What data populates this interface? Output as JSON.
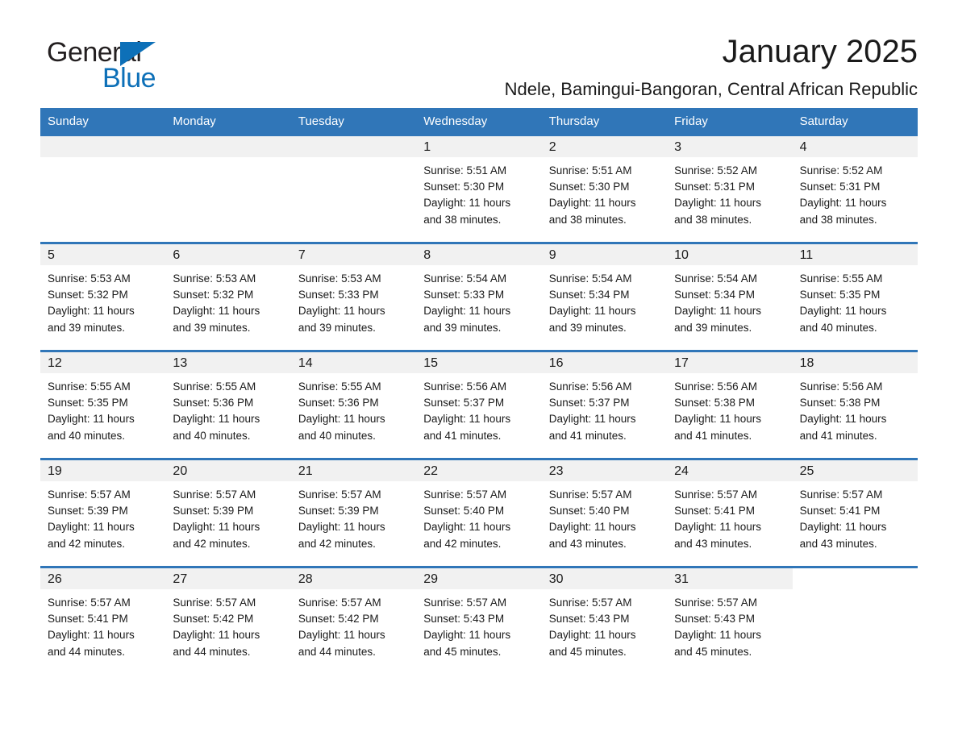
{
  "brand": {
    "word1": "General",
    "word2": "Blue",
    "triangle_color": "#0d70b8",
    "text_color": "#231f20"
  },
  "header": {
    "title": "January 2025",
    "location": "Ndele, Bamingui-Bangoran, Central African Republic",
    "accent_color": "#3076b8",
    "band_color": "#f1f1f1"
  },
  "calendar": {
    "weekday_headers": [
      "Sunday",
      "Monday",
      "Tuesday",
      "Wednesday",
      "Thursday",
      "Friday",
      "Saturday"
    ],
    "weeks": [
      [
        {
          "day": "",
          "empty": true
        },
        {
          "day": "",
          "empty": true
        },
        {
          "day": "",
          "empty": true
        },
        {
          "day": "1",
          "sunrise": "Sunrise: 5:51 AM",
          "sunset": "Sunset: 5:30 PM",
          "daylight": "Daylight: 11 hours and 38 minutes."
        },
        {
          "day": "2",
          "sunrise": "Sunrise: 5:51 AM",
          "sunset": "Sunset: 5:30 PM",
          "daylight": "Daylight: 11 hours and 38 minutes."
        },
        {
          "day": "3",
          "sunrise": "Sunrise: 5:52 AM",
          "sunset": "Sunset: 5:31 PM",
          "daylight": "Daylight: 11 hours and 38 minutes."
        },
        {
          "day": "4",
          "sunrise": "Sunrise: 5:52 AM",
          "sunset": "Sunset: 5:31 PM",
          "daylight": "Daylight: 11 hours and 38 minutes."
        }
      ],
      [
        {
          "day": "5",
          "sunrise": "Sunrise: 5:53 AM",
          "sunset": "Sunset: 5:32 PM",
          "daylight": "Daylight: 11 hours and 39 minutes."
        },
        {
          "day": "6",
          "sunrise": "Sunrise: 5:53 AM",
          "sunset": "Sunset: 5:32 PM",
          "daylight": "Daylight: 11 hours and 39 minutes."
        },
        {
          "day": "7",
          "sunrise": "Sunrise: 5:53 AM",
          "sunset": "Sunset: 5:33 PM",
          "daylight": "Daylight: 11 hours and 39 minutes."
        },
        {
          "day": "8",
          "sunrise": "Sunrise: 5:54 AM",
          "sunset": "Sunset: 5:33 PM",
          "daylight": "Daylight: 11 hours and 39 minutes."
        },
        {
          "day": "9",
          "sunrise": "Sunrise: 5:54 AM",
          "sunset": "Sunset: 5:34 PM",
          "daylight": "Daylight: 11 hours and 39 minutes."
        },
        {
          "day": "10",
          "sunrise": "Sunrise: 5:54 AM",
          "sunset": "Sunset: 5:34 PM",
          "daylight": "Daylight: 11 hours and 39 minutes."
        },
        {
          "day": "11",
          "sunrise": "Sunrise: 5:55 AM",
          "sunset": "Sunset: 5:35 PM",
          "daylight": "Daylight: 11 hours and 40 minutes."
        }
      ],
      [
        {
          "day": "12",
          "sunrise": "Sunrise: 5:55 AM",
          "sunset": "Sunset: 5:35 PM",
          "daylight": "Daylight: 11 hours and 40 minutes."
        },
        {
          "day": "13",
          "sunrise": "Sunrise: 5:55 AM",
          "sunset": "Sunset: 5:36 PM",
          "daylight": "Daylight: 11 hours and 40 minutes."
        },
        {
          "day": "14",
          "sunrise": "Sunrise: 5:55 AM",
          "sunset": "Sunset: 5:36 PM",
          "daylight": "Daylight: 11 hours and 40 minutes."
        },
        {
          "day": "15",
          "sunrise": "Sunrise: 5:56 AM",
          "sunset": "Sunset: 5:37 PM",
          "daylight": "Daylight: 11 hours and 41 minutes."
        },
        {
          "day": "16",
          "sunrise": "Sunrise: 5:56 AM",
          "sunset": "Sunset: 5:37 PM",
          "daylight": "Daylight: 11 hours and 41 minutes."
        },
        {
          "day": "17",
          "sunrise": "Sunrise: 5:56 AM",
          "sunset": "Sunset: 5:38 PM",
          "daylight": "Daylight: 11 hours and 41 minutes."
        },
        {
          "day": "18",
          "sunrise": "Sunrise: 5:56 AM",
          "sunset": "Sunset: 5:38 PM",
          "daylight": "Daylight: 11 hours and 41 minutes."
        }
      ],
      [
        {
          "day": "19",
          "sunrise": "Sunrise: 5:57 AM",
          "sunset": "Sunset: 5:39 PM",
          "daylight": "Daylight: 11 hours and 42 minutes."
        },
        {
          "day": "20",
          "sunrise": "Sunrise: 5:57 AM",
          "sunset": "Sunset: 5:39 PM",
          "daylight": "Daylight: 11 hours and 42 minutes."
        },
        {
          "day": "21",
          "sunrise": "Sunrise: 5:57 AM",
          "sunset": "Sunset: 5:39 PM",
          "daylight": "Daylight: 11 hours and 42 minutes."
        },
        {
          "day": "22",
          "sunrise": "Sunrise: 5:57 AM",
          "sunset": "Sunset: 5:40 PM",
          "daylight": "Daylight: 11 hours and 42 minutes."
        },
        {
          "day": "23",
          "sunrise": "Sunrise: 5:57 AM",
          "sunset": "Sunset: 5:40 PM",
          "daylight": "Daylight: 11 hours and 43 minutes."
        },
        {
          "day": "24",
          "sunrise": "Sunrise: 5:57 AM",
          "sunset": "Sunset: 5:41 PM",
          "daylight": "Daylight: 11 hours and 43 minutes."
        },
        {
          "day": "25",
          "sunrise": "Sunrise: 5:57 AM",
          "sunset": "Sunset: 5:41 PM",
          "daylight": "Daylight: 11 hours and 43 minutes."
        }
      ],
      [
        {
          "day": "26",
          "sunrise": "Sunrise: 5:57 AM",
          "sunset": "Sunset: 5:41 PM",
          "daylight": "Daylight: 11 hours and 44 minutes."
        },
        {
          "day": "27",
          "sunrise": "Sunrise: 5:57 AM",
          "sunset": "Sunset: 5:42 PM",
          "daylight": "Daylight: 11 hours and 44 minutes."
        },
        {
          "day": "28",
          "sunrise": "Sunrise: 5:57 AM",
          "sunset": "Sunset: 5:42 PM",
          "daylight": "Daylight: 11 hours and 44 minutes."
        },
        {
          "day": "29",
          "sunrise": "Sunrise: 5:57 AM",
          "sunset": "Sunset: 5:43 PM",
          "daylight": "Daylight: 11 hours and 45 minutes."
        },
        {
          "day": "30",
          "sunrise": "Sunrise: 5:57 AM",
          "sunset": "Sunset: 5:43 PM",
          "daylight": "Daylight: 11 hours and 45 minutes."
        },
        {
          "day": "31",
          "sunrise": "Sunrise: 5:57 AM",
          "sunset": "Sunset: 5:43 PM",
          "daylight": "Daylight: 11 hours and 45 minutes."
        },
        {
          "day": "",
          "empty": true,
          "no_band": true
        }
      ]
    ]
  }
}
